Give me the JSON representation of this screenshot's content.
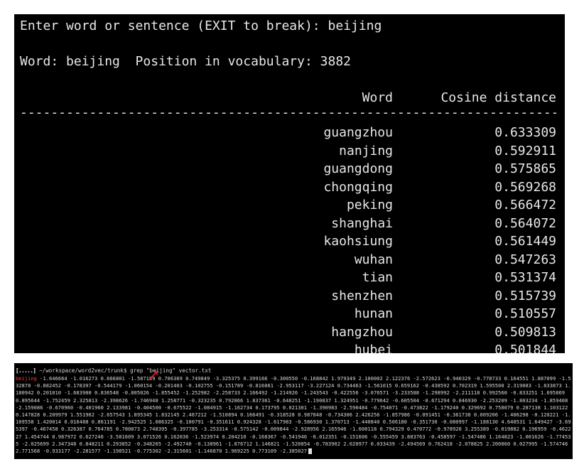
{
  "terminal_top": {
    "prompt": "Enter word or sentence (EXIT to break): beijing",
    "word_info": "Word: beijing  Position in vocabulary: 3882",
    "col_word": "Word",
    "col_distance": "Cosine distance",
    "rule": "------------------------------------------------------------------------",
    "rows": [
      {
        "word": "guangzhou",
        "distance": "0.633309"
      },
      {
        "word": "nanjing",
        "distance": "0.592911"
      },
      {
        "word": "guangdong",
        "distance": "0.575865"
      },
      {
        "word": "chongqing",
        "distance": "0.569268"
      },
      {
        "word": "peking",
        "distance": "0.566472"
      },
      {
        "word": "shanghai",
        "distance": "0.564072"
      },
      {
        "word": "kaohsiung",
        "distance": "0.561449"
      },
      {
        "word": "wuhan",
        "distance": "0.547263"
      },
      {
        "word": "tian",
        "distance": "0.531374"
      },
      {
        "word": "shenzhen",
        "distance": "0.515739"
      },
      {
        "word": "hunan",
        "distance": "0.510557"
      },
      {
        "word": "hangzhou",
        "distance": "0.509813"
      },
      {
        "word": "hubei",
        "distance": "0.501844"
      }
    ]
  },
  "terminal_bottom": {
    "host": "[.....]",
    "command": " ~/workspace/word2vec/trunk$ grep \"beijing\" vector.txt",
    "match": "beijing",
    "vector_text": " -1.646664 -1.016273 0.666801 -1.587189 0.706369 0.749849 -3.325375 0.399166 -0.300550 -0.168842 1.979349 2.100002 2.122376 -2.572623 -0.940329 -0.778733 0.164551 1.887099 -1.532878 -0.882452 -0.178397 -0.544179 -1.060154 -0.201403 -0.102755 -0.151789 -0.816061 -2.953117 -3.227124 0.734463 -1.561015 0.659162 -0.438592 0.702319 1.595500 2.319083 -1.833873 1.180942 0.201010 -1.683900 0.836548 -0.805026 -1.855452 -1.252982 -2.258733 2.166492 -1.214926 -1.243543 -0.422556 -3.076571 -3.233588 -1.298992 -2.211118 0.992560 -0.833251 1.695869 0.895644 -1.752459 2.325813 -2.398626 -1.746948 1.258771 -0.323235 0.792866 1.837361 -0.648251 -1.190837 1.324951 -0.779642 -0.605504 -0.671294 0.046930 -2.253209 -1.803234 -1.859408 -2.159086 -0.670960 -0.401960 2.133981 -0.404500 -0.675522 -1.084915 -1.162734 0.173795 0.021301 -1.390983 -2.590484 -0.754071 -0.473822 -1.179240 0.329692 0.758079 0.287138 1.103122 0.147828 0.209979 1.551962 -2.657543 1.895345 1.832145 2.467212 -1.510894 0.166491 -0.318528 0.987848 -0.734306 2.426256 -1.857986 -0.091451 -0.361738 0.009206 -1.406298 -0.120221 -1.109558 1.420014 0.016488 0.861191 -2.942525 1.086325 -0.100791 -0.351611 0.924328 -1.617983 -0.586930 1.370713 -1.440840 0.506180 -0.351730 -0.080997 -1.188130 4.640531 1.649427 -3.695397 -0.467458 0.326387 0.764785 0.780873 2.748395 -0.397785 -3.253314 -0.575142 -0.009844 -2.928956 2.165946 -1.600118 0.794329 0.470772 -0.978920 3.255389 -0.019882 0.196959 -0.462227 1.454744 0.987972 0.627246 -3.581609 3.071526 0.162036 -1.523974 0.204210 -0.168367 -0.541940 -0.012351 -0.151606 -0.555459 3.883763 -0.458597 -1.547486 1.164823 -1.001626 -1.774535 -2.025699 2.347348 0.848211 0.293852 -0.348265 -2.492740 -0.138961 -1.876712 1.146821 -1.520854 -0.783902 2.020977 0.033439 -2.494569 0.762418 -2.078825 2.200860 0.027995 -1.574746 2.771568 -0.933177 -2.281577 -1.198521 -0.775302 -2.315601 -1.146870 1.969225 0.773109 -2.385027"
  }
}
